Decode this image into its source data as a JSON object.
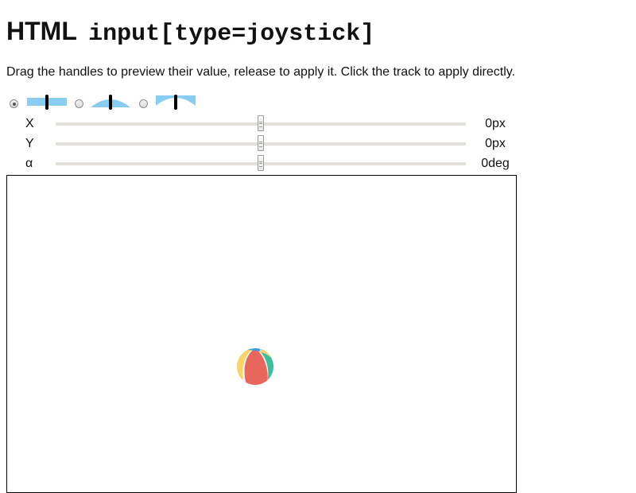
{
  "header": {
    "title_main": "HTML",
    "title_code": "input[type=joystick]",
    "instructions": "Drag the handles to preview their value, release to apply it. Click the track to apply directly."
  },
  "mode_selector": {
    "selected_index": 0,
    "options": [
      {
        "icon": "flat-track-icon",
        "checked": true
      },
      {
        "icon": "convex-track-icon",
        "checked": false
      },
      {
        "icon": "concave-track-icon",
        "checked": false
      }
    ],
    "accent_color": "#88ccf1",
    "handle_color": "#000000"
  },
  "sliders": [
    {
      "label": "X",
      "value_text": "0px",
      "position": 0.5
    },
    {
      "label": "Y",
      "value_text": "0px",
      "position": 0.5
    },
    {
      "label": "α",
      "value_text": "0deg",
      "position": 0.5
    }
  ],
  "stage": {
    "object_icon": "beach-ball-icon",
    "ball_colors": [
      "#e8665c",
      "#f8d366",
      "#3dbd9d",
      "#3aa0e0",
      "#f5f5f5"
    ]
  }
}
